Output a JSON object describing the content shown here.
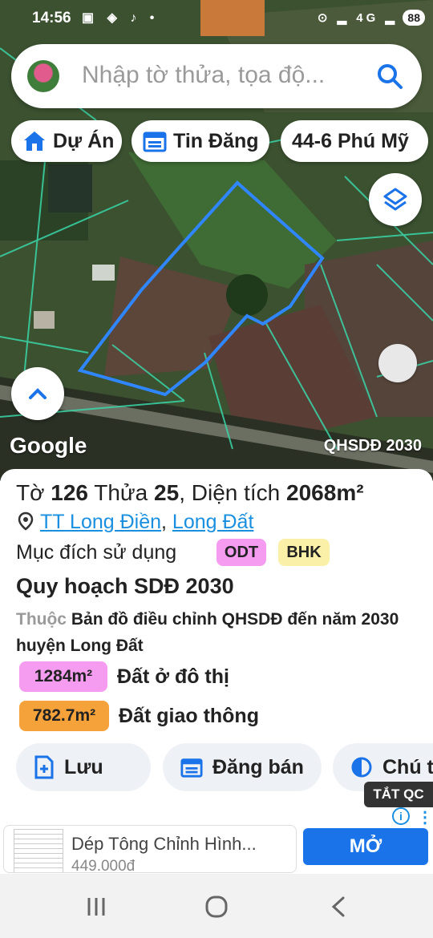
{
  "status_bar": {
    "time": "14:56",
    "left_icons": "▣ ◈ ♪ •",
    "right_icons": "⊙ ▂ 4G ▂",
    "battery": "88"
  },
  "search": {
    "placeholder": "Nhập tờ thửa, tọa độ..."
  },
  "chips": [
    {
      "label": "Dự Án",
      "icon": "home-icon"
    },
    {
      "label": "Tin Đăng",
      "icon": "calendar-icon"
    },
    {
      "label": "44-6 Phú Mỹ",
      "icon": ""
    }
  ],
  "map": {
    "attribution": "Google",
    "layer_name": "QHSDĐ 2030",
    "parcel_outline_color": "#2f86ff",
    "grid_line_color": "#3ad6a8"
  },
  "parcel": {
    "sheet_label": "Tờ",
    "sheet_no": "126",
    "plot_label": "Thửa",
    "plot_no": "25",
    "area_label": ", Diện tích",
    "area_value": "2068m²",
    "location_1": "TT Long Điền",
    "location_sep": ", ",
    "location_2": "Long Đất",
    "purpose_label": "Mục đích sử dụng",
    "purpose_codes": [
      "ODT",
      "BHK"
    ]
  },
  "planning": {
    "title": "Quy hoạch SDĐ 2030",
    "belongs_prefix": "Thuộc",
    "description": "Bản đồ điều chỉnh QHSDĐ đến năm 2030 huyện Long Đất",
    "areas": [
      {
        "value": "1284m²",
        "label": "Đất ở đô thị",
        "color": "#f59cf0"
      },
      {
        "value": "782.7m²",
        "label": "Đất giao thông",
        "color": "#f5a23a"
      }
    ]
  },
  "actions": [
    {
      "label": "Lưu",
      "icon": "add-file-icon"
    },
    {
      "label": "Đăng bán",
      "icon": "calendar-icon"
    },
    {
      "label": "Chú t",
      "icon": "contrast-icon"
    }
  ],
  "ad": {
    "close_label": "TẮT QC",
    "info": "i",
    "more": "⋮",
    "title": "Dép Tông Chỉnh Hình...",
    "price": "449.000đ",
    "open_label": "MỞ"
  }
}
